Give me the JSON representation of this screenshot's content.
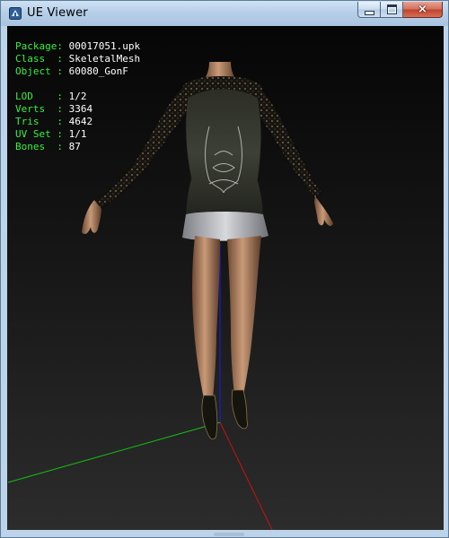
{
  "window": {
    "title": "UE Viewer",
    "controls": {
      "minimize": "minimize",
      "maximize": "maximize",
      "close": "×"
    }
  },
  "info": {
    "package": {
      "label": "Package:",
      "value": "00017051.upk"
    },
    "class": {
      "label": "Class  :",
      "value": "SkeletalMesh"
    },
    "object": {
      "label": "Object :",
      "value": "60080_GonF"
    },
    "lod": {
      "label": "LOD    :",
      "value": "1/2"
    },
    "verts": {
      "label": "Verts  :",
      "value": "3364"
    },
    "tris": {
      "label": "Tris   :",
      "value": "4642"
    },
    "uvset": {
      "label": "UV Set :",
      "value": "1/1"
    },
    "bones": {
      "label": "Bones  :",
      "value": "87"
    }
  },
  "colors": {
    "info_key": "#39f03f",
    "info_value": "#ffffff",
    "axis_x": "#cc1010",
    "axis_y": "#12c212",
    "axis_z": "#1a1ad0"
  }
}
